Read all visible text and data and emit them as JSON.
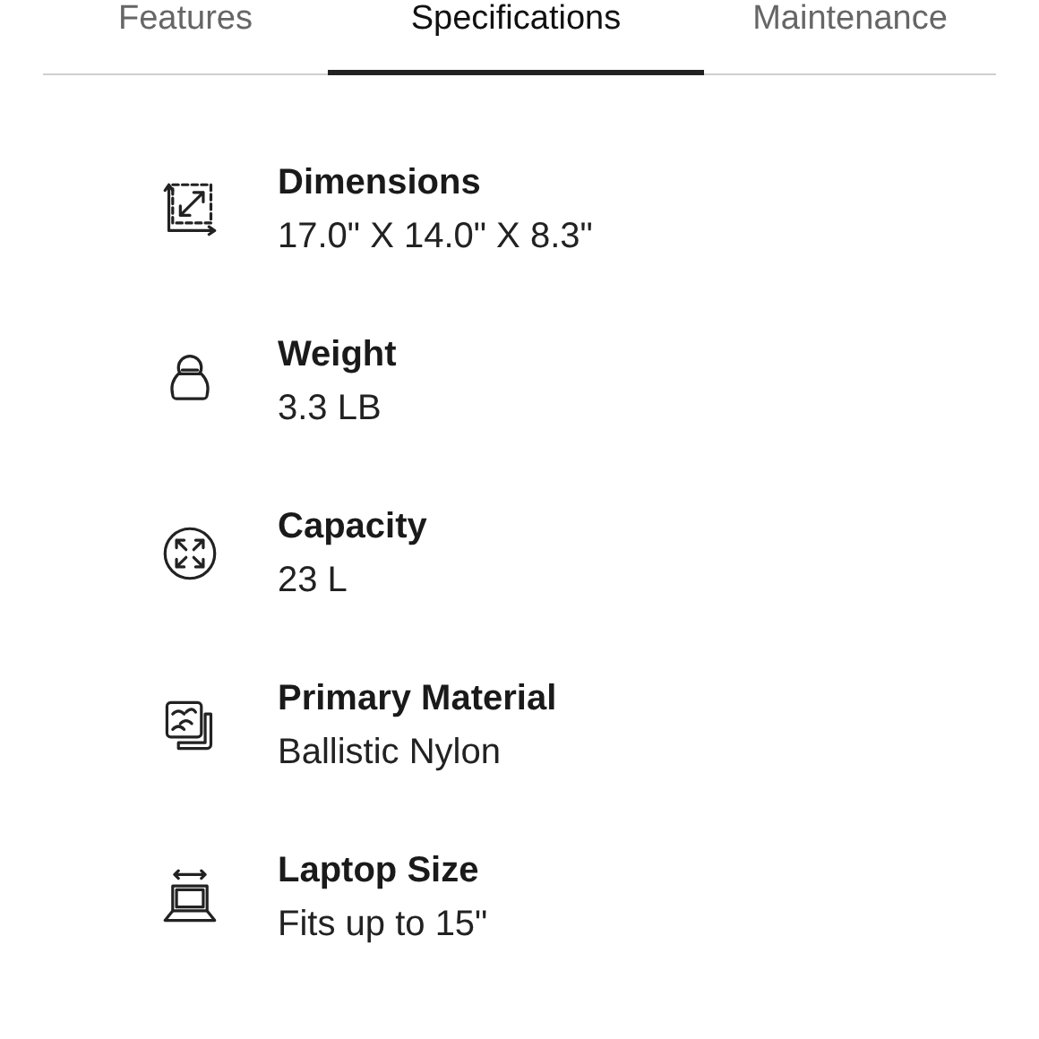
{
  "tabs": [
    {
      "label": "Features",
      "selected": false
    },
    {
      "label": "Specifications",
      "selected": true
    },
    {
      "label": "Maintenance",
      "selected": false
    }
  ],
  "specs": [
    {
      "kind": "dimensions",
      "title": "Dimensions",
      "value": "17.0\" X 14.0\" X 8.3\""
    },
    {
      "kind": "weight",
      "title": "Weight",
      "value": "3.3 LB"
    },
    {
      "kind": "capacity",
      "title": "Capacity",
      "value": "23 L"
    },
    {
      "kind": "material",
      "title": "Primary Material",
      "value": "Ballistic Nylon"
    },
    {
      "kind": "laptop",
      "title": "Laptop Size",
      "value": "Fits up to 15\""
    }
  ]
}
